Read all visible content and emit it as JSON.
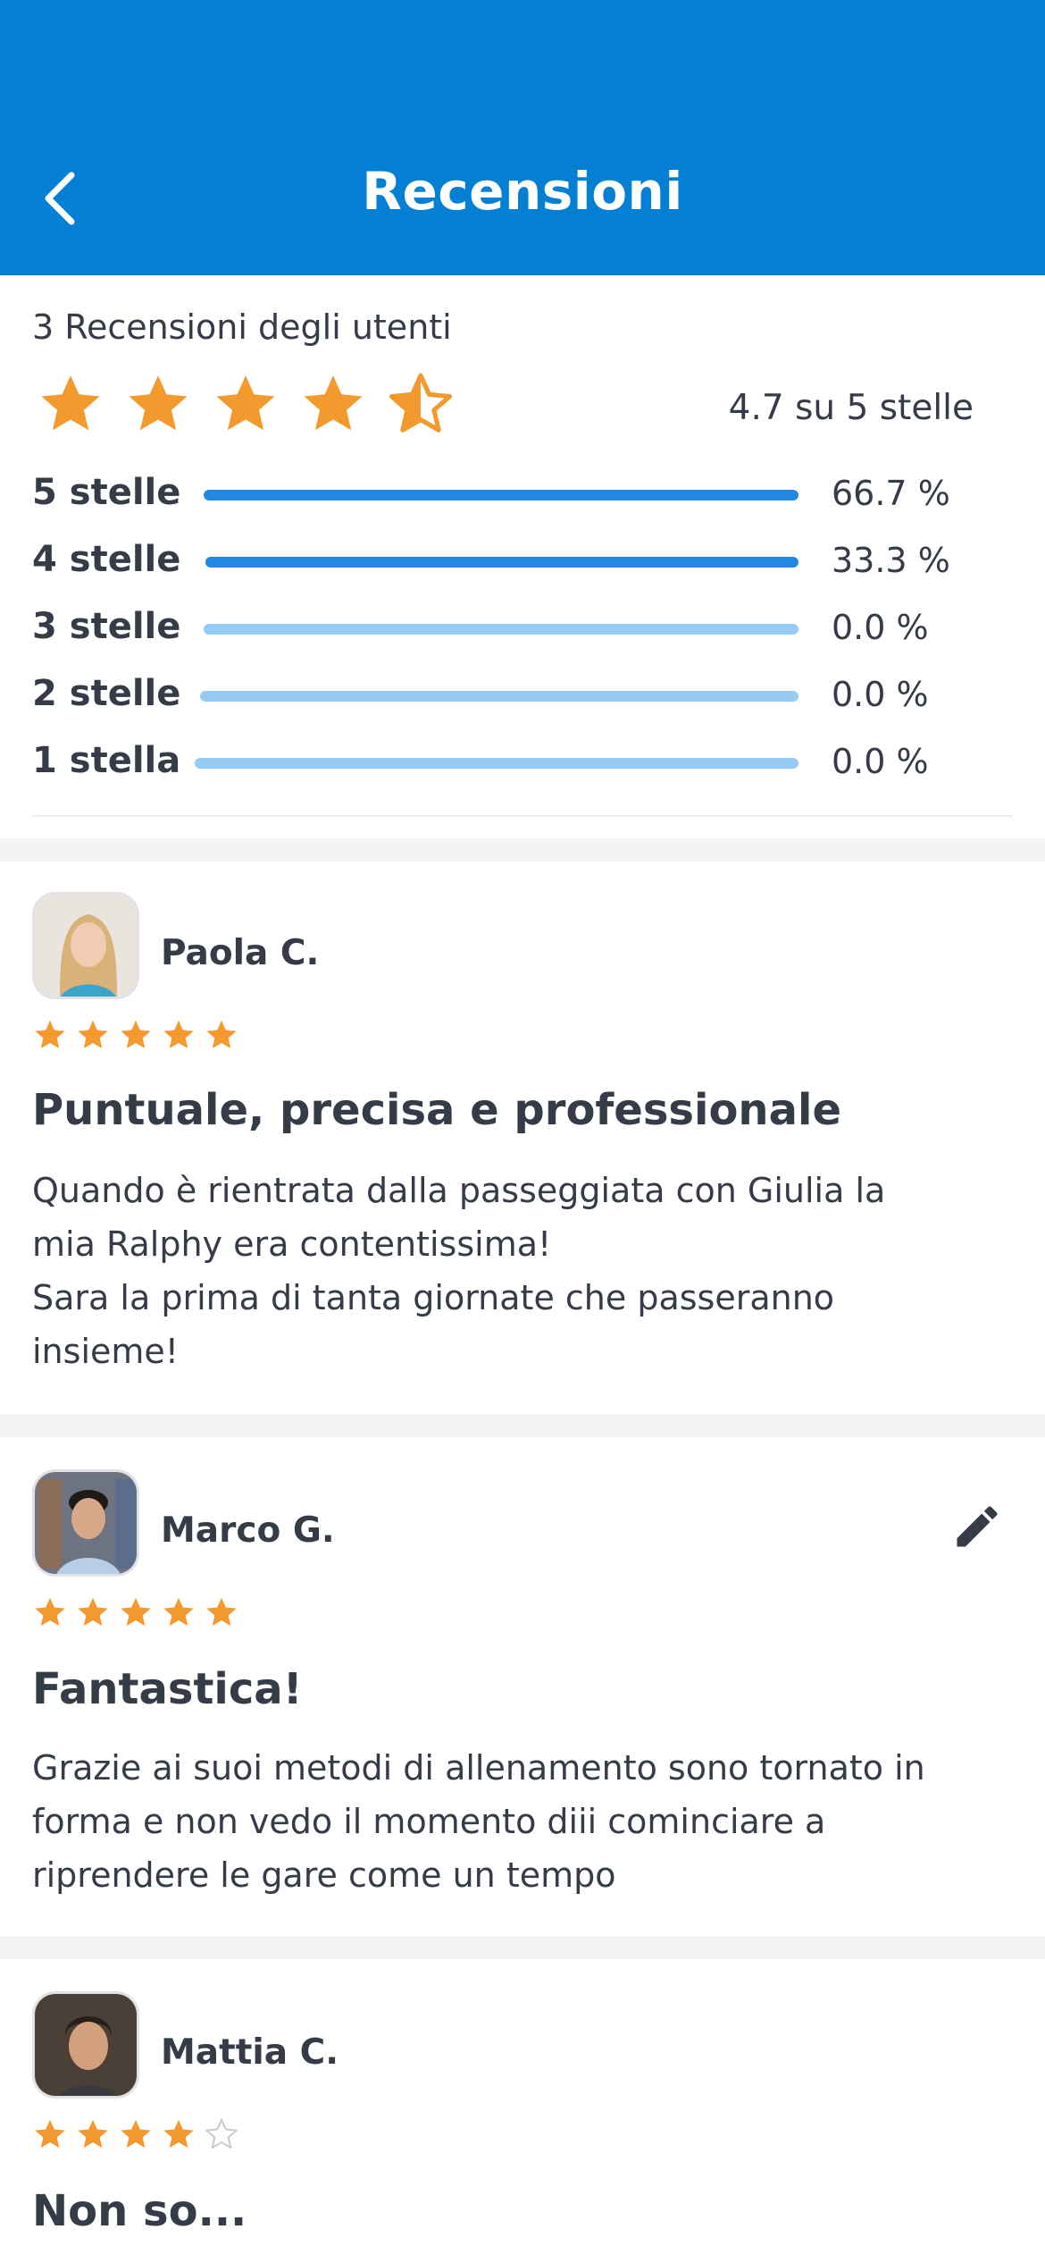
{
  "header": {
    "title": "Recensioni",
    "back_icon": "chevron-left-icon",
    "background": "#0380d3"
  },
  "summary": {
    "count_label": "3 Recensioni degli utenti",
    "average_text": "4.7 su 5 stelle",
    "average_rating": 4.7,
    "star_color": "#f29a2e",
    "distribution": [
      {
        "label": "5 stelle",
        "percent_text": "66.7 %",
        "fraction": 0.667
      },
      {
        "label": "4 stelle",
        "percent_text": "33.3 %",
        "fraction": 0.333
      },
      {
        "label": "3 stelle",
        "percent_text": "0.0 %",
        "fraction": 0.0
      },
      {
        "label": "2 stelle",
        "percent_text": "0.0 %",
        "fraction": 0.0
      },
      {
        "label": "1 stella",
        "percent_text": "0.0 %",
        "fraction": 0.0
      }
    ]
  },
  "reviews": [
    {
      "name": "Paola C.",
      "rating": 5,
      "title": "Puntuale, precisa e professionale",
      "body": "Quando è rientrata dalla passeggiata con Giulia la\nmia Ralphy era contentissima!\nSara la prima di tanta giornate che passeranno\ninsieme!",
      "editable": false
    },
    {
      "name": "Marco G.",
      "rating": 5,
      "title": "Fantastica!",
      "body": "Grazie ai suoi metodi di allenamento sono tornato in\nforma e non vedo il momento diii cominciare a\nriprendere le gare come un tempo",
      "editable": true,
      "edit_icon": "pencil-icon"
    },
    {
      "name": "Mattia C.",
      "rating": 4,
      "title": "Non so...",
      "body": "",
      "editable": false
    }
  ]
}
